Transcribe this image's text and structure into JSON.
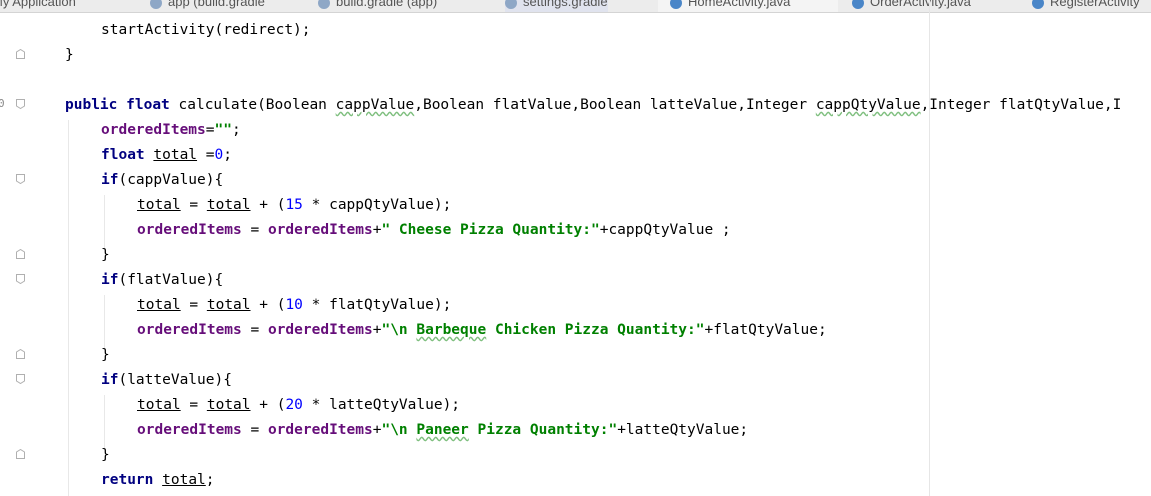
{
  "tabs": [
    {
      "label": "My Application",
      "icon": "android-icon",
      "color": "#9fc35b"
    },
    {
      "label": "app (build.gradle",
      "icon": "gradle-icon",
      "color": "#8ea7c6"
    },
    {
      "label": "build.gradle (app)",
      "icon": "gradle-icon",
      "color": "#8ea7c6"
    },
    {
      "label": "settings.gradle",
      "icon": "gradle-icon",
      "color": "#8ea7c6"
    },
    {
      "label": "HomeActivity.java",
      "icon": "class-icon",
      "color": "#4a86c8",
      "active": true
    },
    {
      "label": "OrderActivity.java",
      "icon": "class-icon",
      "color": "#4a86c8"
    },
    {
      "label": "RegisterActivity",
      "icon": "class-icon",
      "color": "#4a86c8"
    }
  ],
  "gutter_marker": "0",
  "colors": {
    "keyword": "#000080",
    "field": "#660e7a",
    "string": "#008000",
    "number": "#0000ff"
  },
  "code": {
    "l1": {
      "a": "startActivity(redirect);"
    },
    "l2": {
      "a": "}"
    },
    "l3": {
      "kw1": "public",
      "kw2": "float",
      "a": " calculate(Boolean ",
      "p1": "cappValue",
      "b": ",Boolean flatValue,Boolean latteValue,Integer ",
      "p2": "cappQtyValue",
      "c": ",Integer flatQtyValue,I"
    },
    "l4": {
      "f": "orderedItems",
      "a": "=",
      "s": "\"\"",
      "b": ";"
    },
    "l5": {
      "kw": "float",
      "v": "total",
      "a": " =",
      "n": "0",
      "b": ";"
    },
    "l6": {
      "kw": "if",
      "a": "(cappValue){"
    },
    "l7": {
      "v1": "total",
      "a": " = ",
      "v2": "total",
      "b": " + (",
      "n": "15",
      "c": " * cappQtyValue);"
    },
    "l8": {
      "f1": "orderedItems",
      "a": " = ",
      "f2": "orderedItems",
      "b": "+",
      "s": "\" Cheese Pizza Quantity:\"",
      "c": "+cappQtyValue ;"
    },
    "l9": {
      "a": "}"
    },
    "l10": {
      "kw": "if",
      "a": "(flatValue){"
    },
    "l11": {
      "v1": "total",
      "a": " = ",
      "v2": "total",
      "b": " + (",
      "n": "10",
      "c": " * flatQtyValue);"
    },
    "l12": {
      "f1": "orderedItems",
      "a": " = ",
      "f2": "orderedItems",
      "b": "+",
      "s1": "\"\\n ",
      "s2": "Barbeque",
      "s3": " Chicken Pizza Quantity:\"",
      "c": "+flatQtyValue;"
    },
    "l13": {
      "a": "}"
    },
    "l14": {
      "kw": "if",
      "a": "(latteValue){"
    },
    "l15": {
      "v1": "total",
      "a": " = ",
      "v2": "total",
      "b": " + (",
      "n": "20",
      "c": " * latteQtyValue);"
    },
    "l16": {
      "f1": "orderedItems",
      "a": " = ",
      "f2": "orderedItems",
      "b": "+",
      "s1": "\"\\n ",
      "s2": "Paneer",
      "s3": " Pizza Quantity:\"",
      "c": "+latteQtyValue;"
    },
    "l17": {
      "a": "}"
    },
    "l18": {
      "kw": "return",
      "a": " ",
      "v": "total",
      "b": ";"
    }
  }
}
